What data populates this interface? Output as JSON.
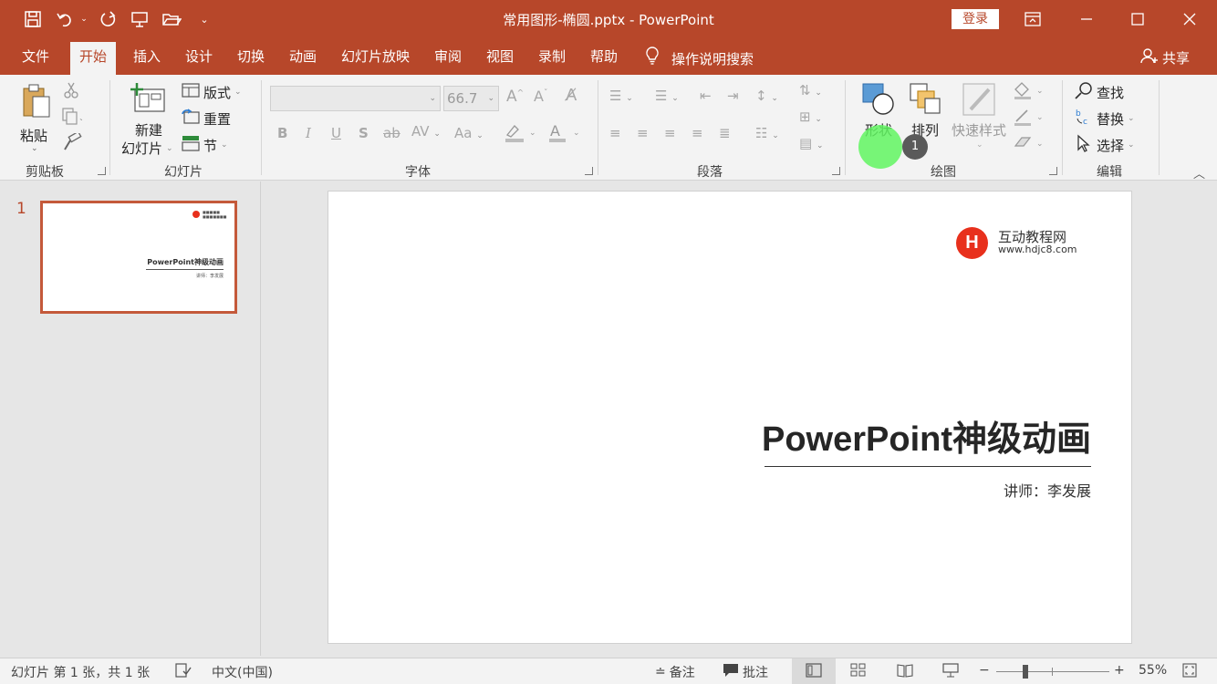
{
  "titlebar": {
    "title": "常用图形-椭圆.pptx  -  PowerPoint",
    "login_label": "登录",
    "quick_access_icons": [
      "save-icon",
      "undo-icon",
      "redo-icon",
      "present-from-start-icon",
      "open-icon",
      "customize-icon"
    ],
    "window_controls": [
      "restore-ribbon-icon",
      "minimize-icon",
      "maximize-icon",
      "close-icon"
    ],
    "bg_color": "#b7472a"
  },
  "tabs": {
    "file": "文件",
    "home": "开始",
    "insert": "插入",
    "design": "设计",
    "transitions": "切换",
    "animations": "动画",
    "slideshow": "幻灯片放映",
    "review": "审阅",
    "view": "视图",
    "record": "录制",
    "help": "帮助",
    "tell_me": "操作说明搜索",
    "share": "共享"
  },
  "ribbon": {
    "clipboard": {
      "label": "剪贴板",
      "paste": "粘贴"
    },
    "slides": {
      "label": "幻灯片",
      "new_slide_line1": "新建",
      "new_slide_line2": "幻灯片",
      "layout": "版式",
      "reset": "重置",
      "section": "节"
    },
    "font": {
      "label": "字体",
      "font_name": "",
      "font_size": "66.7"
    },
    "paragraph": {
      "label": "段落"
    },
    "drawing": {
      "label": "绘图",
      "shapes": "形状",
      "arrange": "排列",
      "quick_styles": "快速样式"
    },
    "editing": {
      "label": "编辑",
      "find": "查找",
      "replace": "替换",
      "select": "选择"
    }
  },
  "overlay": {
    "step_number": "1"
  },
  "slide_panel": {
    "slide_number": "1",
    "thumb_title": "PowerPoint神级动画",
    "thumb_lecturer": "讲师：李发展"
  },
  "slide": {
    "logo_letter": "H",
    "logo_name": "互动教程网",
    "logo_url": "www.hdjc8.com",
    "title": "PowerPoint神级动画",
    "lecturer": "讲师：李发展"
  },
  "statusbar": {
    "slide_info": "幻灯片 第 1 张，共 1 张",
    "language": "中文(中国)",
    "notes": "备注",
    "comments": "批注",
    "zoom_minus": "−",
    "zoom_plus": "+",
    "zoom_level": "55%"
  }
}
